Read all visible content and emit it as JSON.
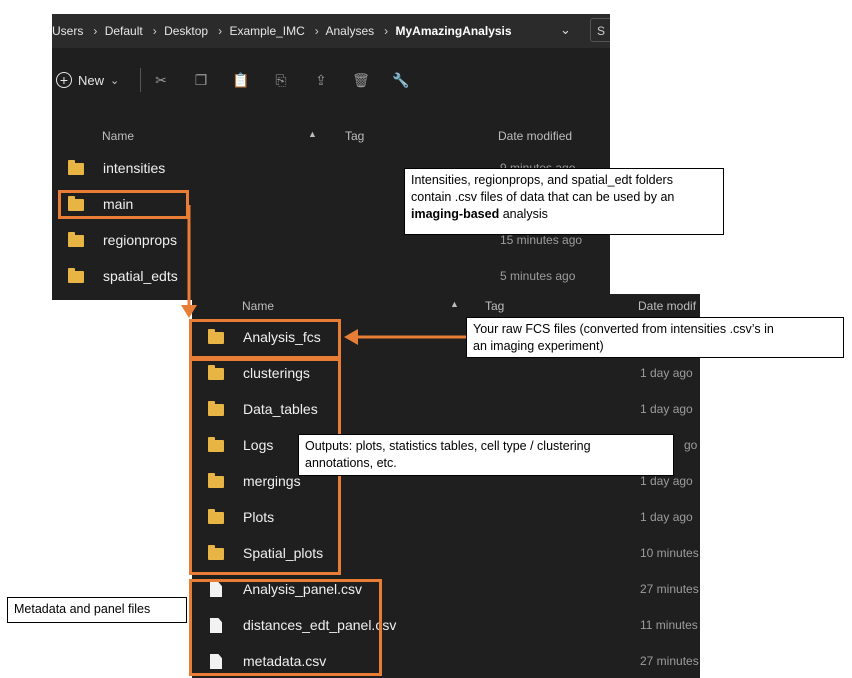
{
  "breadcrumb": {
    "items": [
      "Users",
      "Default",
      "Desktop",
      "Example_IMC",
      "Analyses"
    ],
    "current": "MyAmazingAnalysis",
    "search_stub": "S"
  },
  "toolbar": {
    "new_label": "New"
  },
  "top_listing": {
    "headers": {
      "name": "Name",
      "tag": "Tag",
      "date": "Date modified"
    },
    "rows": [
      {
        "name": "intensities",
        "date": "9 minutes ago"
      },
      {
        "name": "main",
        "date": ""
      },
      {
        "name": "regionprops",
        "date": "15 minutes ago"
      },
      {
        "name": "spatial_edts",
        "date": "5 minutes ago"
      }
    ]
  },
  "bottom_listing": {
    "headers": {
      "name": "Name",
      "tag": "Tag",
      "date": "Date modif"
    },
    "rows": [
      {
        "name": "Analysis_fcs",
        "date": ""
      },
      {
        "name": "clusterings",
        "date": "1 day ago"
      },
      {
        "name": "Data_tables",
        "date": "1 day ago"
      },
      {
        "name": "Logs",
        "date": "go"
      },
      {
        "name": "mergings",
        "date": "1 day ago"
      },
      {
        "name": "Plots",
        "date": "1 day ago"
      },
      {
        "name": "Spatial_plots",
        "date": "10 minutes"
      },
      {
        "name": "Analysis_panel.csv",
        "date": "27 minutes"
      },
      {
        "name": "distances_edt_panel.csv",
        "date": "11 minutes"
      },
      {
        "name": "metadata.csv",
        "date": "27 minutes"
      }
    ]
  },
  "callouts": {
    "imaging": {
      "line1": "Intensities, regionprops, and spatial_edt folders",
      "line2": "contain .csv files of data that can be used by an",
      "bold": "imaging-based",
      "rest": " analysis"
    },
    "raw_fcs": {
      "line1": "Your raw FCS files (converted from intensities .csv’s in",
      "line2": "an imaging experiment)"
    },
    "outputs": {
      "line1": "Outputs: plots, statistics tables, cell type  / clustering",
      "line2": "annotations, etc."
    },
    "metadata": {
      "text": "Metadata and panel files"
    }
  },
  "colors": {
    "annotation_orange": "#e87d35",
    "folder_yellow": "#e8b544",
    "explorer_bg": "#1f1f1f"
  }
}
